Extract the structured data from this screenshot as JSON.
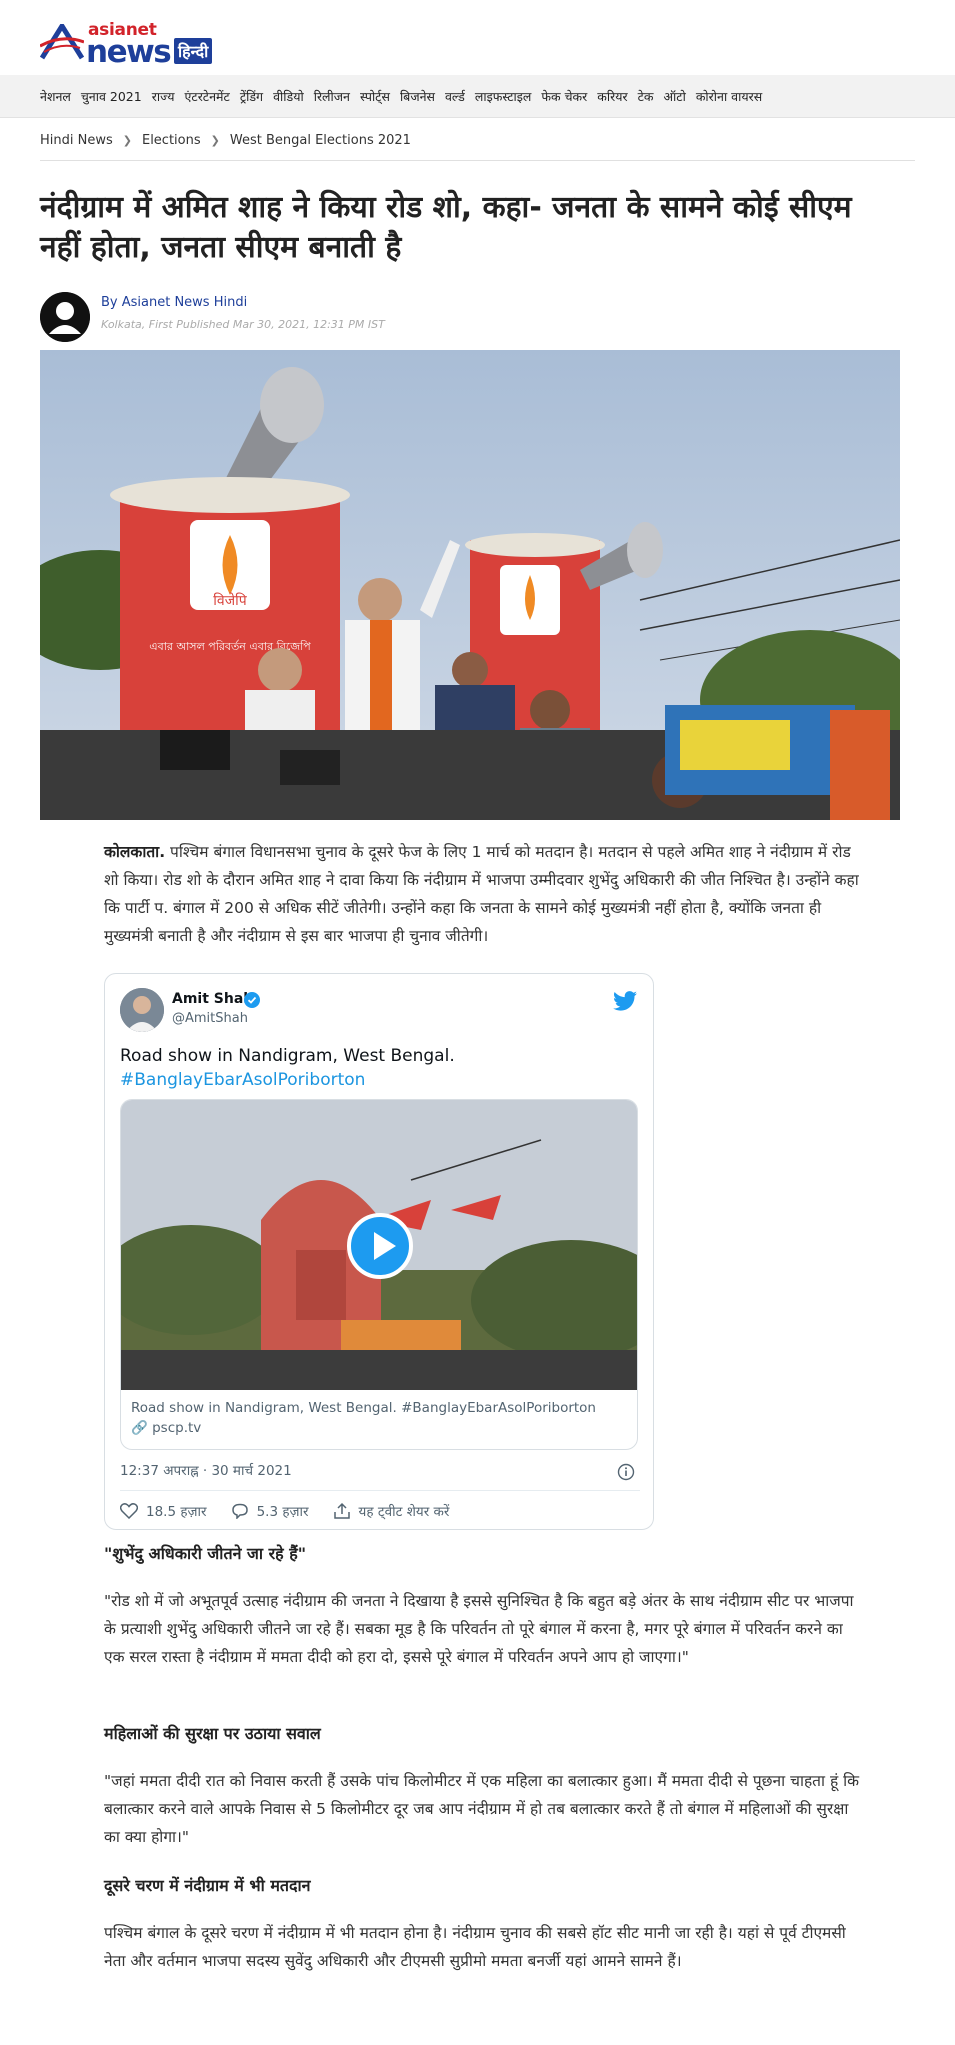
{
  "brand": {
    "small": "asianet",
    "big": "news",
    "hindi": "हिन्दी"
  },
  "nav": {
    "items": [
      "नेशनल",
      "चुनाव 2021",
      "राज्य",
      "एंटरटेनमेंट",
      "ट्रेंडिंग",
      "वीडियो",
      "रिलीजन",
      "स्पोर्ट्स",
      "बिजनेस",
      "वर्ल्ड",
      "लाइफस्टाइल",
      "फेक चेकर",
      "करियर",
      "टेक",
      "ऑटो",
      "कोरोना वायरस"
    ]
  },
  "breadcrumb": [
    "Hindi News",
    "Elections",
    "West Bengal Elections 2021"
  ],
  "article": {
    "title": "नंदीग्राम में अमित शाह ने किया रोड शो, कहा- जनता के सामने कोई सीएम नहीं होता, जनता सीएम बनाती है",
    "author": "By Asianet News Hindi",
    "meta": "Kolkata, First Published Mar 30, 2021, 12:31 PM IST",
    "lead_bold": "कोलकाता.",
    "lead": " पश्चिम बंगाल विधानसभा चुनाव के दूसरे फेज के लिए 1 मार्च को मतदान है। मतदान से पहले अमित शाह ने नंदीग्राम में रोड शो किया। रोड शो के दौरान अमित शाह ने दावा किया कि नंदीग्राम में भाजपा उम्मीदवार शुभेंदु अधिकारी की जीत निश्चित है। उन्होंने कहा कि पार्टी प. बंगाल में 200 से अधिक सीटें जीतेगी। उन्होंने कहा कि जनता के सामने कोई मुख्यमंत्री नहीं होता है, क्योंकि जनता ही मुख्यमंत्री बनाती है और नंदीग्राम से इस बार भाजपा ही चुनाव जीतेगी।",
    "subhead1": "\"शुभेंदु अधिकारी जीतने जा रहे हैं\"",
    "para2": "\"रोड शो में जो अभूतपूर्व उत्साह नंदीग्राम की जनता ने दिखाया है इससे सुनिश्चित है कि बहुत बड़े अंतर के साथ नंदीग्राम सीट पर भाजपा के प्रत्याशी शुभेंदु अधिकारी जीतने जा रहे हैं। सबका मूड है कि परिवर्तन तो पूरे बंगाल में करना है, मगर पूरे बंगाल में परिवर्तन करने का एक सरल रास्ता है नंदीग्राम में ममता दीदी को हरा दो, इससे पूरे बंगाल में परिवर्तन अपने आप हो जाएगा।\"",
    "subhead2": "महिलाओं की सुरक्षा पर उठाया सवाल",
    "para3": "\"जहां ममता दीदी रात को निवास करती हैं उसके पांच किलोमीटर में एक महिला का बलात्कार हुआ। मैं ममता दीदी से पूछना चाहता हूं कि बलात्कार करने वाले आपके निवास से 5 किलोमीटर दूर जब आप नंदीग्राम में हो तब बलात्कार करते हैं तो बंगाल में महिलाओं की सुरक्षा का क्या होगा।\"",
    "subhead3": "दूसरे चरण में नंदीग्राम में भी मतदान",
    "para4": "पश्चिम बंगाल के दूसरे चरण में नंदीग्राम में भी मतदान होना है। नंदीग्राम चुनाव की सबसे हॉट सीट मानी जा रही है। यहां से पूर्व टीएमसी नेता और वर्तमान भाजपा सदस्य सुवेंदु अधिकारी और टीएमसी सुप्रीमो ममता बनर्जी यहां आमने सामने हैं।"
  },
  "hero_image": {
    "banner_text": "विजेपि",
    "banner_slogan": "এবার আসল পরিবর্তন এবার বিজেপি"
  },
  "tweet": {
    "name": "Amit Shah",
    "handle": "@AmitShah",
    "text": "Road show in Nandigram, West Bengal.",
    "hashtag": "#BanglayEbarAsolPoriborton",
    "card_text": "Road show in Nandigram, West Bengal. #BanglayEbarAsolPoriborton",
    "card_link": "pscp.tv",
    "time": "12:37 अपराह्न · 30 मार्च 2021",
    "likes": "18.5 हज़ार",
    "replies": "5.3 हज़ार",
    "share": "यह ट्वीट शेयर करें"
  },
  "colors": {
    "brand_blue": "#1e3f9a",
    "brand_red": "#d2232a",
    "twitter_blue": "#1d9bf0",
    "nav_bg": "#f2f2f2"
  }
}
